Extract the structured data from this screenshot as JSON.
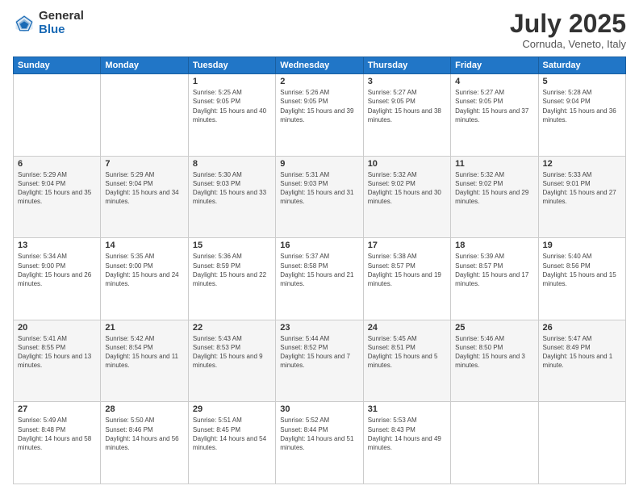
{
  "logo": {
    "general": "General",
    "blue": "Blue"
  },
  "title": "July 2025",
  "location": "Cornuda, Veneto, Italy",
  "weekdays": [
    "Sunday",
    "Monday",
    "Tuesday",
    "Wednesday",
    "Thursday",
    "Friday",
    "Saturday"
  ],
  "weeks": [
    [
      {
        "day": "",
        "info": ""
      },
      {
        "day": "",
        "info": ""
      },
      {
        "day": "1",
        "info": "Sunrise: 5:25 AM\nSunset: 9:05 PM\nDaylight: 15 hours and 40 minutes."
      },
      {
        "day": "2",
        "info": "Sunrise: 5:26 AM\nSunset: 9:05 PM\nDaylight: 15 hours and 39 minutes."
      },
      {
        "day": "3",
        "info": "Sunrise: 5:27 AM\nSunset: 9:05 PM\nDaylight: 15 hours and 38 minutes."
      },
      {
        "day": "4",
        "info": "Sunrise: 5:27 AM\nSunset: 9:05 PM\nDaylight: 15 hours and 37 minutes."
      },
      {
        "day": "5",
        "info": "Sunrise: 5:28 AM\nSunset: 9:04 PM\nDaylight: 15 hours and 36 minutes."
      }
    ],
    [
      {
        "day": "6",
        "info": "Sunrise: 5:29 AM\nSunset: 9:04 PM\nDaylight: 15 hours and 35 minutes."
      },
      {
        "day": "7",
        "info": "Sunrise: 5:29 AM\nSunset: 9:04 PM\nDaylight: 15 hours and 34 minutes."
      },
      {
        "day": "8",
        "info": "Sunrise: 5:30 AM\nSunset: 9:03 PM\nDaylight: 15 hours and 33 minutes."
      },
      {
        "day": "9",
        "info": "Sunrise: 5:31 AM\nSunset: 9:03 PM\nDaylight: 15 hours and 31 minutes."
      },
      {
        "day": "10",
        "info": "Sunrise: 5:32 AM\nSunset: 9:02 PM\nDaylight: 15 hours and 30 minutes."
      },
      {
        "day": "11",
        "info": "Sunrise: 5:32 AM\nSunset: 9:02 PM\nDaylight: 15 hours and 29 minutes."
      },
      {
        "day": "12",
        "info": "Sunrise: 5:33 AM\nSunset: 9:01 PM\nDaylight: 15 hours and 27 minutes."
      }
    ],
    [
      {
        "day": "13",
        "info": "Sunrise: 5:34 AM\nSunset: 9:00 PM\nDaylight: 15 hours and 26 minutes."
      },
      {
        "day": "14",
        "info": "Sunrise: 5:35 AM\nSunset: 9:00 PM\nDaylight: 15 hours and 24 minutes."
      },
      {
        "day": "15",
        "info": "Sunrise: 5:36 AM\nSunset: 8:59 PM\nDaylight: 15 hours and 22 minutes."
      },
      {
        "day": "16",
        "info": "Sunrise: 5:37 AM\nSunset: 8:58 PM\nDaylight: 15 hours and 21 minutes."
      },
      {
        "day": "17",
        "info": "Sunrise: 5:38 AM\nSunset: 8:57 PM\nDaylight: 15 hours and 19 minutes."
      },
      {
        "day": "18",
        "info": "Sunrise: 5:39 AM\nSunset: 8:57 PM\nDaylight: 15 hours and 17 minutes."
      },
      {
        "day": "19",
        "info": "Sunrise: 5:40 AM\nSunset: 8:56 PM\nDaylight: 15 hours and 15 minutes."
      }
    ],
    [
      {
        "day": "20",
        "info": "Sunrise: 5:41 AM\nSunset: 8:55 PM\nDaylight: 15 hours and 13 minutes."
      },
      {
        "day": "21",
        "info": "Sunrise: 5:42 AM\nSunset: 8:54 PM\nDaylight: 15 hours and 11 minutes."
      },
      {
        "day": "22",
        "info": "Sunrise: 5:43 AM\nSunset: 8:53 PM\nDaylight: 15 hours and 9 minutes."
      },
      {
        "day": "23",
        "info": "Sunrise: 5:44 AM\nSunset: 8:52 PM\nDaylight: 15 hours and 7 minutes."
      },
      {
        "day": "24",
        "info": "Sunrise: 5:45 AM\nSunset: 8:51 PM\nDaylight: 15 hours and 5 minutes."
      },
      {
        "day": "25",
        "info": "Sunrise: 5:46 AM\nSunset: 8:50 PM\nDaylight: 15 hours and 3 minutes."
      },
      {
        "day": "26",
        "info": "Sunrise: 5:47 AM\nSunset: 8:49 PM\nDaylight: 15 hours and 1 minute."
      }
    ],
    [
      {
        "day": "27",
        "info": "Sunrise: 5:49 AM\nSunset: 8:48 PM\nDaylight: 14 hours and 58 minutes."
      },
      {
        "day": "28",
        "info": "Sunrise: 5:50 AM\nSunset: 8:46 PM\nDaylight: 14 hours and 56 minutes."
      },
      {
        "day": "29",
        "info": "Sunrise: 5:51 AM\nSunset: 8:45 PM\nDaylight: 14 hours and 54 minutes."
      },
      {
        "day": "30",
        "info": "Sunrise: 5:52 AM\nSunset: 8:44 PM\nDaylight: 14 hours and 51 minutes."
      },
      {
        "day": "31",
        "info": "Sunrise: 5:53 AM\nSunset: 8:43 PM\nDaylight: 14 hours and 49 minutes."
      },
      {
        "day": "",
        "info": ""
      },
      {
        "day": "",
        "info": ""
      }
    ]
  ]
}
